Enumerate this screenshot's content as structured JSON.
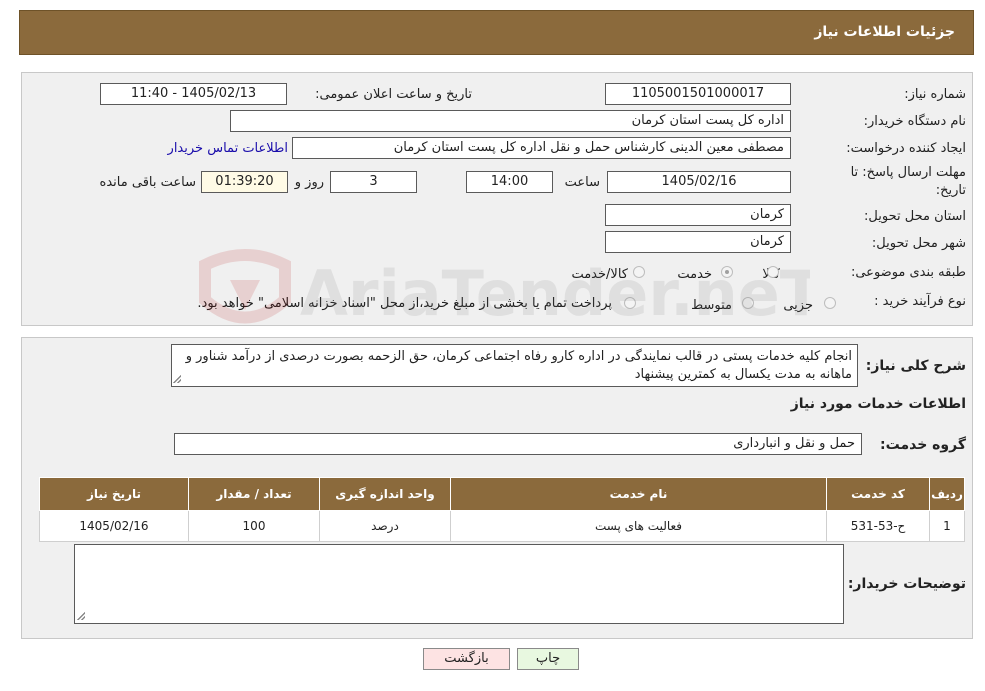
{
  "header": {
    "title": "جزئیات اطلاعات نیاز"
  },
  "form": {
    "need_number_label": "شماره نیاز:",
    "need_number": "1105001501000017",
    "announce_label": "تاریخ و ساعت اعلان عمومی:",
    "announce_value": "1405/02/13 - 11:40",
    "buyer_org_label": "نام دستگاه خریدار:",
    "buyer_org": "اداره کل پست استان کرمان",
    "creator_label": "ایجاد کننده درخواست:",
    "creator": "مصطفی معین الدینی کارشناس حمل و نقل اداره کل پست استان کرمان",
    "contact_link": "اطلاعات تماس خریدار",
    "deadline_label_1": "مهلت ارسال پاسخ: تا",
    "deadline_label_2": "تاریخ:",
    "deadline_date": "1405/02/16",
    "time_label": "ساعت",
    "deadline_time": "14:00",
    "days_value": "3",
    "days_label": "روز و",
    "remaining_time": "01:39:20",
    "remaining_label": "ساعت باقی مانده",
    "province_label": "استان محل تحویل:",
    "province": "کرمان",
    "city_label": "شهر محل تحویل:",
    "city": "کرمان",
    "category_label": "طبقه بندی موضوعی:",
    "category_options": [
      "کالا",
      "خدمت",
      "کالا/خدمت"
    ],
    "category_selected": "خدمت",
    "process_label": "نوع فرآیند خرید :",
    "process_options": [
      "جزیی",
      "متوسط"
    ],
    "process_note": "پرداخت تمام یا بخشی از مبلغ خرید،از محل \"اسناد خزانه اسلامی\" خواهد بود."
  },
  "summary": {
    "label": "شرح کلی نیاز:",
    "text": "انجام کلیه خدمات پستی در قالب نمایندگی در اداره کارو رفاه اجتماعی کرمان، حق الزحمه بصورت درصدی از درآمد شناور و ماهانه به مدت یکسال به کمترین پیشنهاد"
  },
  "services": {
    "section_title": "اطلاعات خدمات مورد نیاز",
    "group_label": "گروه خدمت:",
    "group_value": "حمل و نقل و انبارداری",
    "columns": [
      "ردیف",
      "کد خدمت",
      "نام خدمت",
      "واحد اندازه گیری",
      "تعداد / مقدار",
      "تاریخ نیاز"
    ],
    "rows": [
      {
        "row": "1",
        "code": "ح-53-531",
        "name": "فعالیت های پست",
        "unit": "درصد",
        "qty": "100",
        "date": "1405/02/16"
      }
    ]
  },
  "buyer_notes": {
    "label": "توضیحات خریدار:",
    "text": ""
  },
  "actions": {
    "print": "چاپ",
    "back": "بازگشت"
  },
  "watermark": {
    "text": "AriaTender.neT"
  },
  "colors": {
    "header": "#8b6a3c",
    "link": "#1a0dab",
    "back_button": "#fde3e3",
    "print_button": "#e8f8e0"
  }
}
